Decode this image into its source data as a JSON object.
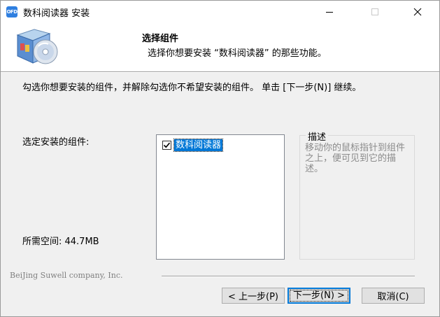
{
  "window": {
    "title": "数科阅读器 安装",
    "app_icon_text": "OFD"
  },
  "header": {
    "title": "选择组件",
    "subtitle": "选择你想要安装 “数科阅读器” 的那些功能。",
    "graphic_icon": "installer-box-cd-icon"
  },
  "body": {
    "instruction": "勾选你想要安装的组件，并解除勾选你不希望安装的组件。 单击 [下一步(N)] 继续。",
    "select_label": "选定安装的组件:",
    "space_label": "所需空间: 44.7MB",
    "components": [
      {
        "label": "数科阅读器",
        "checked": true,
        "selected": true
      }
    ],
    "description": {
      "title": "描述",
      "text": "移动你的鼠标指针到组件之上，便可见到它的描述。"
    },
    "brand": "BeiJing Suwell company, Inc."
  },
  "buttons": {
    "back": "< 上一步(P)",
    "next": "下一步(N) >",
    "cancel": "取消(C)"
  },
  "colors": {
    "accent": "#0078d7",
    "window_bg": "#f0f0f0",
    "desc_text": "#8a8a8a"
  }
}
